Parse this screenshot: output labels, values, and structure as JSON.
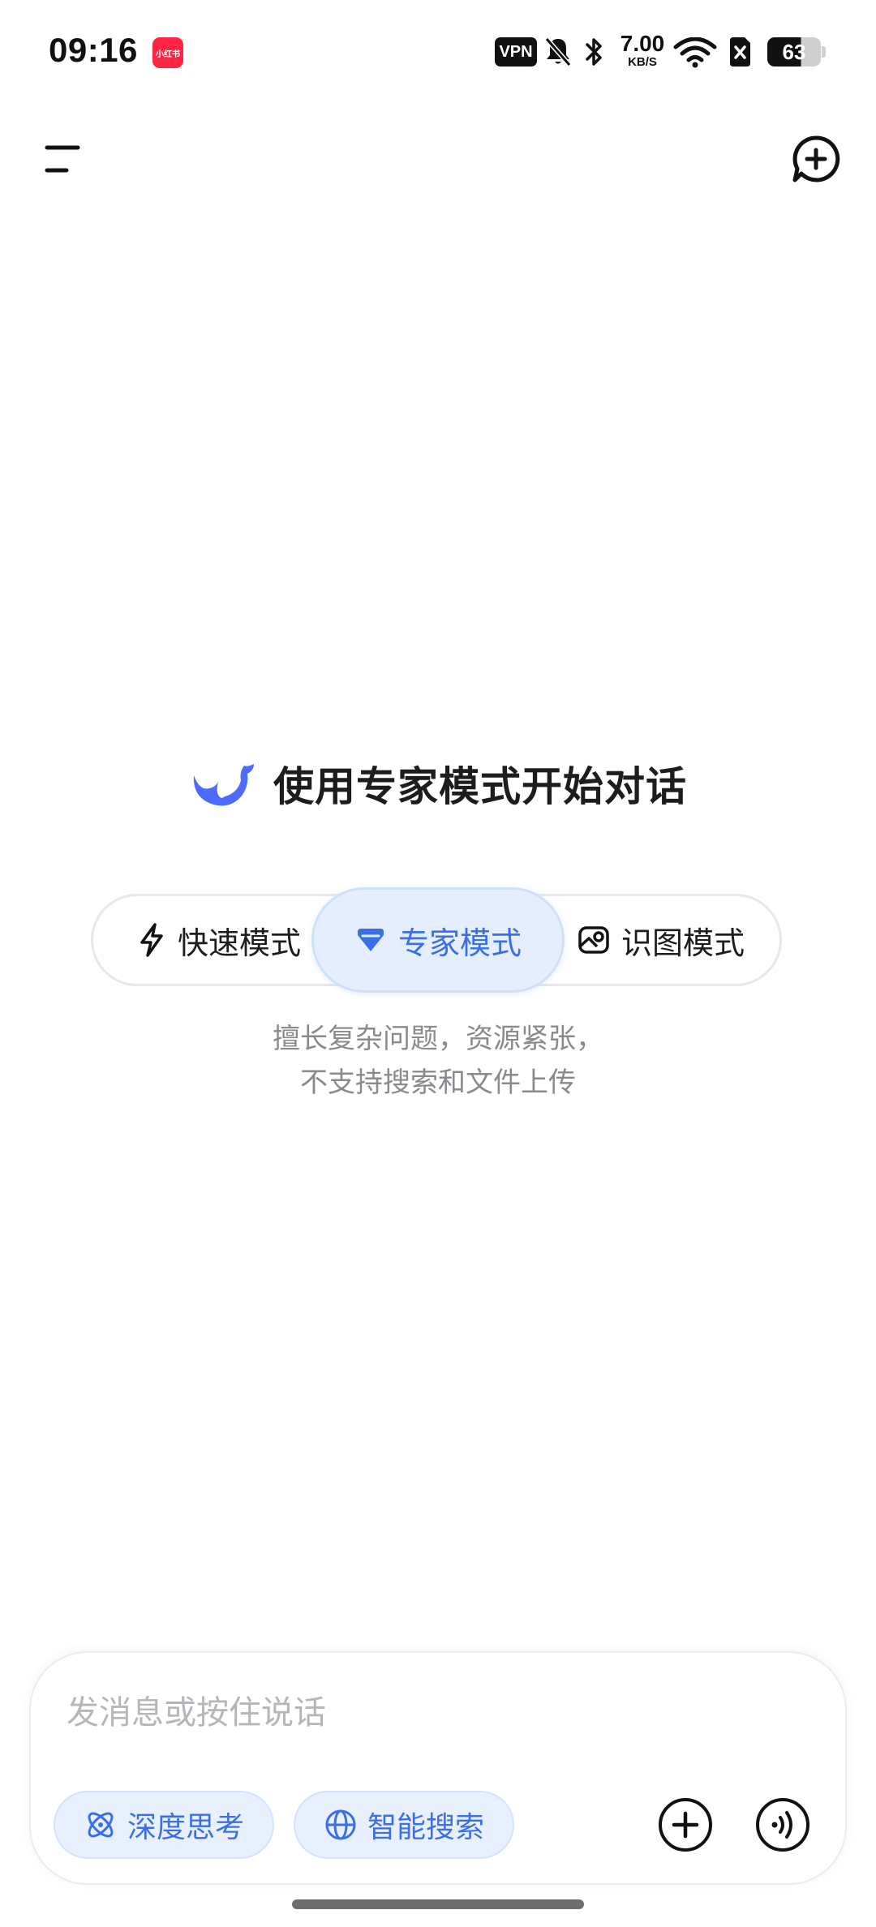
{
  "status_bar": {
    "time": "09:16",
    "app_icon_label": "小红书",
    "vpn_label": "VPN",
    "net_speed_value": "7.00",
    "net_speed_unit": "KB/S",
    "battery_level": "63"
  },
  "header": {
    "menu_icon": "menu-icon",
    "new_chat_icon": "new-chat-icon"
  },
  "hero": {
    "title": "使用专家模式开始对话"
  },
  "modes": {
    "options": [
      {
        "label": "快速模式",
        "icon": "lightning-icon"
      },
      {
        "label": "专家模式",
        "icon": "gem-icon"
      },
      {
        "label": "识图模式",
        "icon": "image-icon"
      }
    ],
    "selected": "专家模式",
    "description_line1": "擅长复杂问题，资源紧张，",
    "description_line2": "不支持搜索和文件上传"
  },
  "composer": {
    "placeholder": "发消息或按住说话",
    "value": "",
    "chips": [
      {
        "label": "深度思考",
        "icon": "atom-icon"
      },
      {
        "label": "智能搜索",
        "icon": "globe-icon"
      }
    ],
    "attach_icon": "plus-circle-icon",
    "voice_icon": "voice-icon"
  },
  "colors": {
    "accent": "#3b6fe8",
    "accent_bg": "#e4eefe",
    "muted_text": "#8a8a8e",
    "placeholder": "#b6b6ba"
  }
}
